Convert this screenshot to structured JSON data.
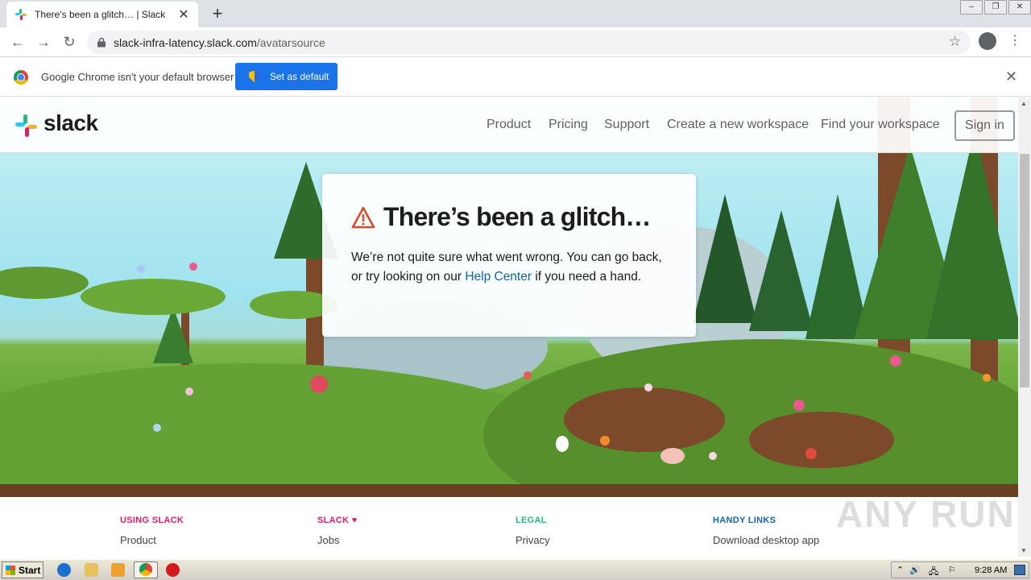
{
  "browser": {
    "tab_title": "There's been a glitch… | Slack",
    "tab_close": "✕",
    "new_tab": "+",
    "window_controls": [
      "–",
      "❐",
      "✕"
    ],
    "url_host": "slack-infra-latency.slack.com",
    "url_path": "/avatarsource",
    "infobar_text": "Google Chrome isn't your default browser",
    "infobar_button": "Set as default",
    "infobar_close": "✕",
    "icons": {
      "back": "←",
      "forward": "→",
      "reload": "↻",
      "star": "☆",
      "menu": "⋮"
    }
  },
  "site": {
    "logo_text": "slack",
    "nav": [
      "Product",
      "Pricing",
      "Support",
      "Create a new workspace",
      "Find your workspace"
    ],
    "signin": "Sign in"
  },
  "error_card": {
    "title": "There’s been a glitch…",
    "body_before": "We’re not quite sure what went wrong. You can go back, or try looking on our",
    "link": "Help Center",
    "body_after": "if you need a hand."
  },
  "footer": {
    "columns": [
      {
        "heading": "USING SLACK",
        "color": "#e01e5a",
        "item": "Product"
      },
      {
        "heading": "SLACK ♥",
        "color": "#e01e5a",
        "item": "Jobs"
      },
      {
        "heading": "LEGAL",
        "color": "#2eb67d",
        "item": "Privacy"
      },
      {
        "heading": "HANDY LINKS",
        "color": "#1264a3",
        "item": "Download desktop app"
      }
    ]
  },
  "watermark": "ANY RUN",
  "taskbar": {
    "start": "Start",
    "clock": "9:28 AM",
    "tray_icons": [
      "⌃",
      "🔊",
      "🖧",
      "⚐"
    ]
  },
  "colors": {
    "slack_red": "#e01e5a",
    "slack_blue": "#36c5f0",
    "slack_green": "#2eb67d",
    "slack_yellow": "#ecb22e",
    "link": "#1264a3",
    "chrome_blue": "#1a73e8"
  }
}
